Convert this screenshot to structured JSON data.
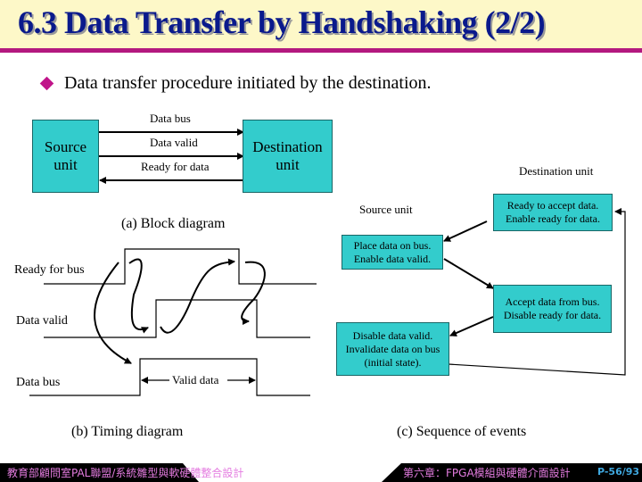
{
  "slide": {
    "title": "6.3 Data Transfer by Handshaking (2/2)",
    "bullet": "Data transfer procedure initiated by the destination.",
    "colors": {
      "title": "#0a1a8c",
      "title_bg": "#fdf8c8",
      "accent": "#b3197f",
      "box_fill": "#33cccc",
      "footer_text": "#e47ce0",
      "page_num": "#3fa8e0"
    }
  },
  "block_diagram": {
    "source_box": "Source unit",
    "destination_box": "Destination unit",
    "signals": [
      {
        "label": "Data bus",
        "direction": "source-to-destination"
      },
      {
        "label": "Data valid",
        "direction": "source-to-destination"
      },
      {
        "label": "Ready for data",
        "direction": "destination-to-source"
      }
    ],
    "caption": "(a) Block diagram"
  },
  "timing_diagram": {
    "signals": [
      "Ready for bus",
      "Data valid",
      "Data bus"
    ],
    "valid_data_label": "Valid data",
    "caption": "(b) Timing diagram"
  },
  "sequence": {
    "destination_header": "Destination unit",
    "source_header": "Source unit",
    "steps": [
      {
        "side": "destination",
        "line1": "Ready to accept data.",
        "line2": "Enable ready for data."
      },
      {
        "side": "source",
        "line1": "Place data on bus.",
        "line2": "Enable data valid."
      },
      {
        "side": "destination",
        "line1": "Accept data from bus.",
        "line2": "Disable ready for data."
      },
      {
        "side": "source",
        "line1": "Disable data valid.",
        "line2": "Invalidate data on bus",
        "line3": "(initial state)."
      }
    ],
    "caption": "(c) Sequence of events"
  },
  "footer": {
    "left": "教育部顧問室PAL聯盟/系統雛型與軟硬體整合設計",
    "right": "第六章：FPGA模組與硬體介面設計",
    "page": "P-56/93"
  }
}
